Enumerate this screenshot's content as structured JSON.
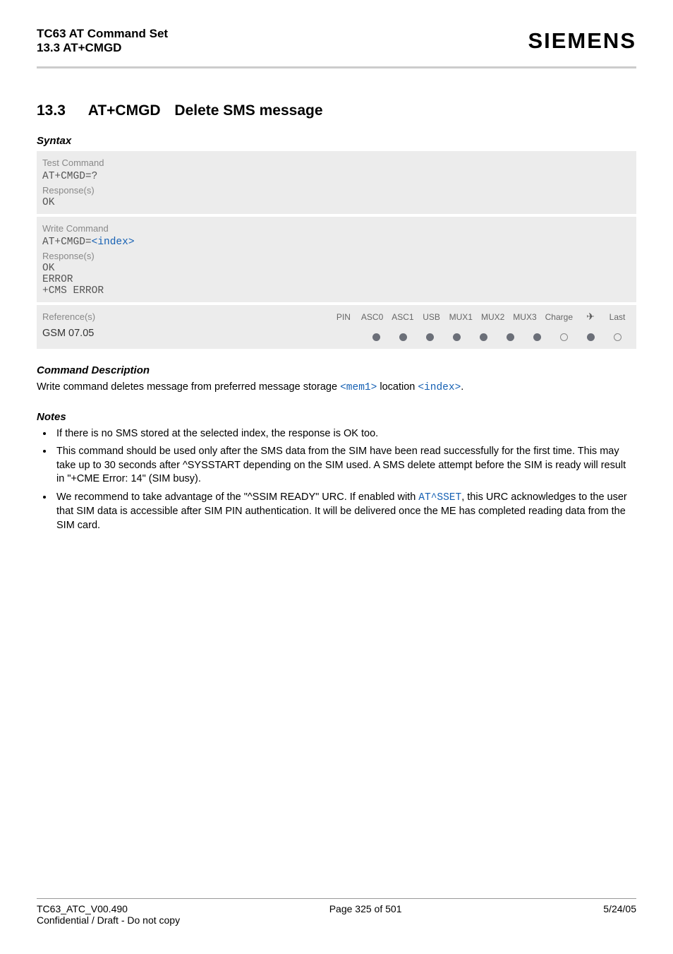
{
  "header": {
    "doc_title": "TC63 AT Command Set",
    "doc_subtitle": "13.3 AT+CMGD",
    "brand": "SIEMENS"
  },
  "section": {
    "number": "13.3",
    "command": "AT+CMGD",
    "title": "Delete SMS message"
  },
  "syntax": {
    "heading": "Syntax",
    "test_command_label": "Test Command",
    "test_command": "AT+CMGD=?",
    "responses_label": "Response(s)",
    "test_response": "OK",
    "write_command_label": "Write Command",
    "write_command_prefix": "AT+CMGD=",
    "write_command_param": "<index>",
    "write_responses": [
      "OK",
      "ERROR",
      "+CMS ERROR"
    ],
    "references_label": "Reference(s)",
    "reference_value": "GSM 07.05",
    "channels": {
      "headers": [
        "PIN",
        "ASC0",
        "ASC1",
        "USB",
        "MUX1",
        "MUX2",
        "MUX3",
        "Charge",
        "✈",
        "Last"
      ],
      "values": [
        "filled",
        "filled",
        "filled",
        "filled",
        "filled",
        "filled",
        "filled",
        "empty",
        "filled",
        "empty"
      ]
    }
  },
  "command_description": {
    "heading": "Command Description",
    "text_prefix": "Write command deletes message from preferred message storage ",
    "param1": "<mem1>",
    "text_mid": " location ",
    "param2": "<index>",
    "text_suffix": "."
  },
  "notes": {
    "heading": "Notes",
    "items": [
      {
        "text": "If there is no SMS stored at the selected index, the response is OK too."
      },
      {
        "text": "This command should be used only after the SMS data from the SIM have been read successfully for the first time. This may take up to 30 seconds after ^SYSSTART depending on the SIM used. A SMS delete attempt before the SIM is ready will result in \"+CME Error: 14\" (SIM busy)."
      },
      {
        "prefix": "We recommend to take advantage of the \"^SSIM READY\" URC. If enabled with ",
        "link": "AT^SSET",
        "suffix": ", this URC acknowledges to the user that SIM data is accessible after SIM PIN authentication. It will be delivered once the ME has completed reading data from the SIM card."
      }
    ]
  },
  "footer": {
    "version": "TC63_ATC_V00.490",
    "page": "Page 325 of 501",
    "date": "5/24/05",
    "confidential": "Confidential / Draft - Do not copy"
  }
}
